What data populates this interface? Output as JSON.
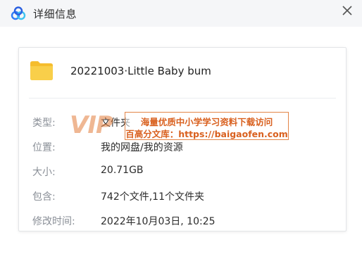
{
  "window": {
    "title": "详细信息"
  },
  "file": {
    "name": "20221003·Little Baby bum",
    "icon": "folder-icon"
  },
  "details": [
    {
      "key": "type",
      "label": "类型:",
      "value": "文件夹"
    },
    {
      "key": "location",
      "label": "位置:",
      "value": "我的网盘/我的资源"
    },
    {
      "key": "size",
      "label": "大小:",
      "value": "20.71GB"
    },
    {
      "key": "contains",
      "label": "包含:",
      "value": "742个文件,11个文件夹"
    },
    {
      "key": "modified",
      "label": "修改时间:",
      "value": "2022年10月03日, 10:25"
    }
  ],
  "watermark": {
    "brand": "VIP",
    "line1": "海量优质中小学学习资料下载访问",
    "line2": "百高分文库：https://baigaofen.com"
  },
  "colors": {
    "titlebar": "#f5f6f8",
    "folder": "#f7c948",
    "accent": "#d9601e"
  }
}
